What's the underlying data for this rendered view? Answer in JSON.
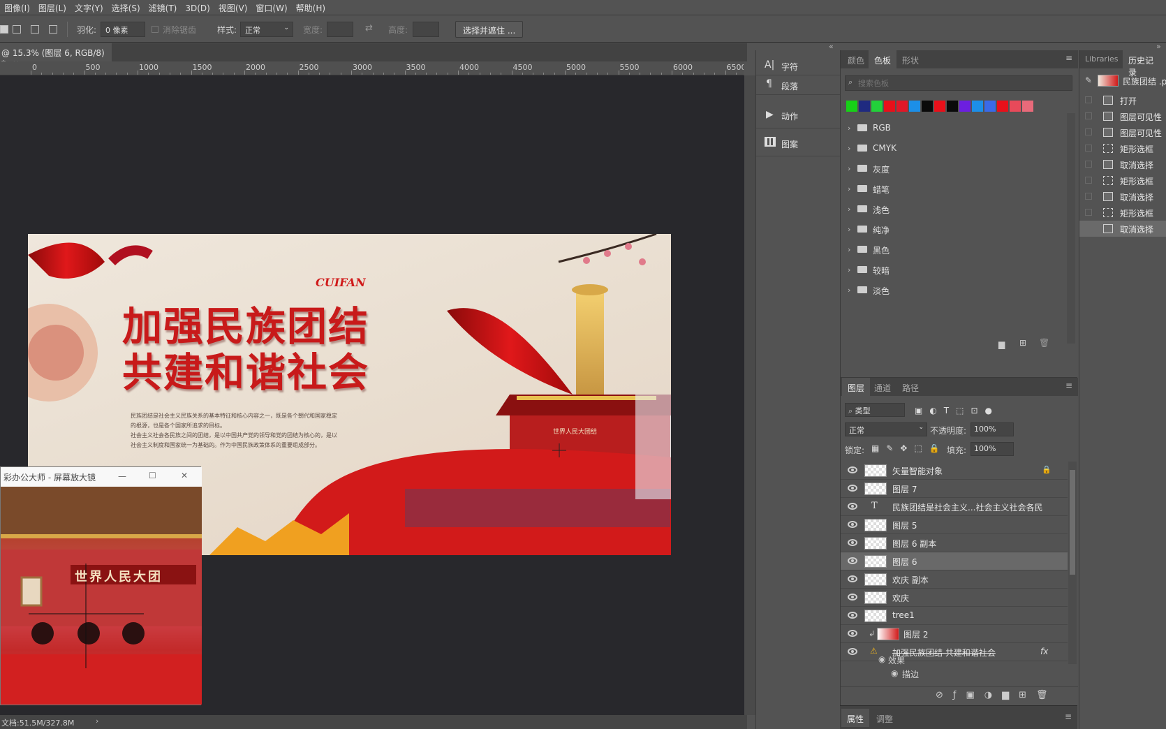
{
  "menu": [
    "图像(I)",
    "图层(L)",
    "文字(Y)",
    "选择(S)",
    "滤镜(T)",
    "3D(D)",
    "视图(V)",
    "窗口(W)",
    "帮助(H)"
  ],
  "options": {
    "feather_label": "羽化:",
    "feather_value": "0 像素",
    "antialias_label": "消除锯齿",
    "style_label": "样式:",
    "style_value": "正常",
    "width_label": "宽度:",
    "height_label": "高度:",
    "select_mask_button": "选择并遮住 ..."
  },
  "document": {
    "tab_title": "@ 15.3% (图层 6, RGB/8) *",
    "close_glyph": "×",
    "status": "文档:51.5M/327.8M",
    "status_arrow": "›"
  },
  "ruler_labels": [
    "0",
    "500",
    "1000",
    "1500",
    "2000",
    "2500",
    "3000",
    "3500",
    "4000",
    "4500",
    "5000",
    "5500",
    "6000",
    "6500"
  ],
  "artwork": {
    "logo": "CUIFAN",
    "title_line1": "加强民族团结",
    "title_line2": "共建和谐社会",
    "body_lines": [
      "民族团结是社会主义民族关系的基本特征和核心内容之一，既是各个朝代和国家稳定",
      "的根源，也是各个国家所追求的目标。",
      "社会主义社会各民族之间的团结，是以中国共产党的领导和党的团结为核心的，是以",
      "社会主义制度和国家统一为基础的。作为中国民族政策体系的重要组成部分。"
    ],
    "gate_sign": "世界人民大团结"
  },
  "dock": {
    "collapse_glyph": "«",
    "items": [
      {
        "icon": "character-icon",
        "label": "字符"
      },
      {
        "icon": "paragraph-icon",
        "label": "段落"
      },
      {
        "icon": "actions-icon",
        "label": "动作"
      },
      {
        "icon": "patterns-icon",
        "label": "图案"
      }
    ]
  },
  "swatches_panel": {
    "tabs": [
      "颜色",
      "色板",
      "形状"
    ],
    "active_tab": "色板",
    "search_placeholder": "搜索色板",
    "colors": [
      "#17d117",
      "#1f2a80",
      "#22d13a",
      "#e8101a",
      "#e01828",
      "#1c8fe8",
      "#0a0a0a",
      "#e8101a",
      "#0a0a0a",
      "#6c1fe0",
      "#1c8fe8",
      "#3a6ae8",
      "#e8101a",
      "#e84a5a",
      "#e86a7a"
    ],
    "folders": [
      "RGB",
      "CMYK",
      "灰度",
      "蜡笔",
      "浅色",
      "纯净",
      "黑色",
      "较暗",
      "淡色"
    ]
  },
  "layers_panel": {
    "tabs": [
      "图层",
      "通道",
      "路径"
    ],
    "active_tab": "图层",
    "filter_label": "类型",
    "blend_mode": "正常",
    "opacity_label": "不透明度:",
    "opacity_value": "100%",
    "lock_label": "锁定:",
    "fill_label": "填充:",
    "fill_value": "100%",
    "fx_label": "fx",
    "layers": [
      {
        "name": "矢量智能对象",
        "kind": "smart",
        "locked": true
      },
      {
        "name": "图层 7",
        "kind": "pixel"
      },
      {
        "name": "民族团结是社会主义...社会主义社会各民",
        "kind": "text"
      },
      {
        "name": "图层 5",
        "kind": "pixel"
      },
      {
        "name": "图层 6 副本",
        "kind": "pixel"
      },
      {
        "name": "图层 6",
        "kind": "pixel",
        "selected": true
      },
      {
        "name": "欢庆 副本",
        "kind": "pixel"
      },
      {
        "name": "欢庆",
        "kind": "pixel"
      },
      {
        "name": "tree1",
        "kind": "pixel"
      },
      {
        "name": "图层 2",
        "kind": "pixel",
        "clipped": true
      },
      {
        "name": "加强民族团结 共建和谐社会",
        "kind": "text-warning",
        "fx": true
      }
    ],
    "effects_label": "效果",
    "stroke_label": "描边",
    "bottom_tabs": [
      "属性",
      "调整"
    ]
  },
  "history_panel": {
    "tabs": [
      "Libraries",
      "历史记录"
    ],
    "active_tab": "历史记录",
    "snapshot": "民族团结 .ps",
    "items": [
      "打开",
      "图层可见性",
      "图层可见性",
      "矩形选框",
      "取消选择",
      "矩形选框",
      "取消选择",
      "矩形选框",
      "取消选择"
    ],
    "selected_index": 8
  },
  "magnifier": {
    "title": "彩办公大师 - 屏幕放大镜",
    "min_glyph": "—",
    "max_glyph": "☐",
    "close_glyph": "✕",
    "gate_sign": "世界人民大团"
  }
}
